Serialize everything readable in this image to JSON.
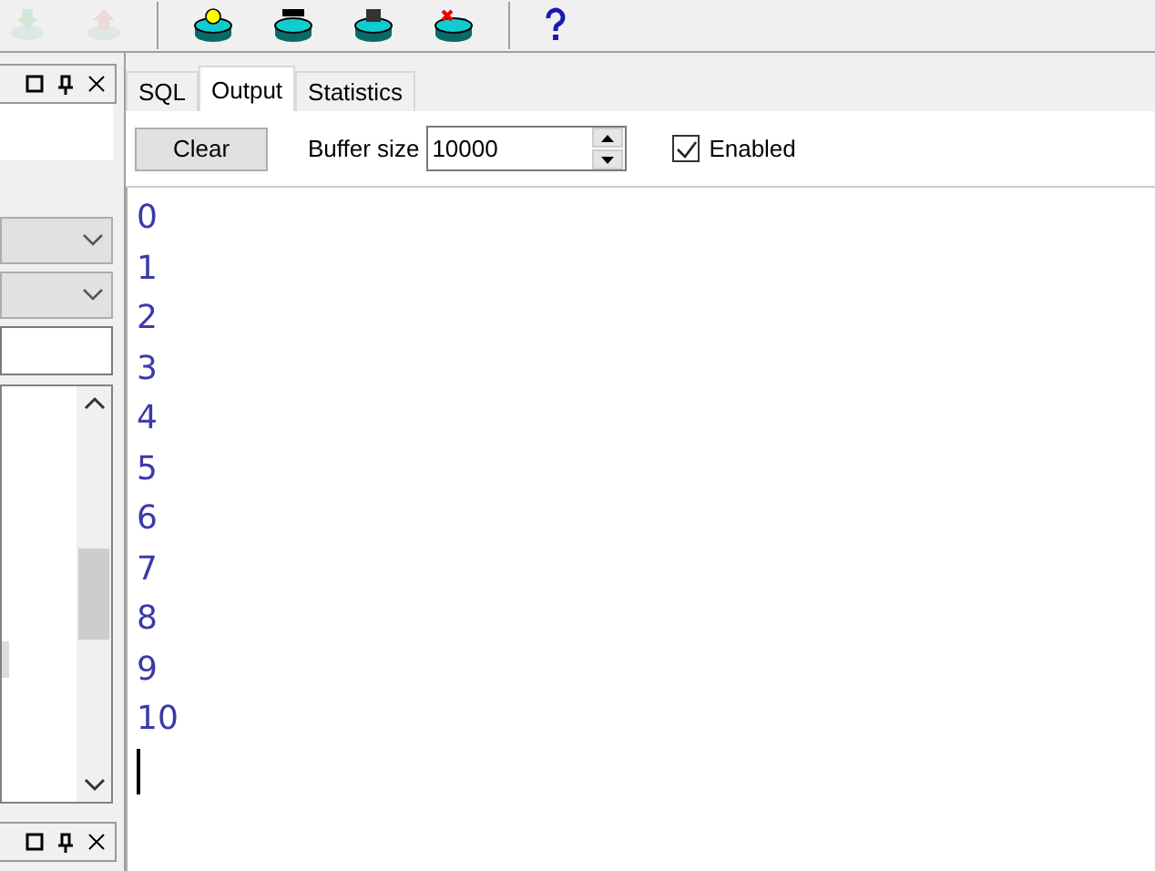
{
  "toolbar": [
    {
      "kind": "import",
      "disabled": true
    },
    {
      "kind": "export",
      "disabled": true
    },
    {
      "kind": "db-bulb",
      "disabled": false
    },
    {
      "kind": "db-label",
      "disabled": false
    },
    {
      "kind": "db-grid",
      "disabled": false
    },
    {
      "kind": "db-delete",
      "disabled": false
    },
    {
      "kind": "help",
      "disabled": false
    }
  ],
  "left_panel": {
    "dropdowns": [
      {
        "disabled": true
      },
      {
        "disabled": true
      }
    ]
  },
  "tabs": [
    {
      "label": "SQL",
      "selected": false
    },
    {
      "label": "Output",
      "selected": true
    },
    {
      "label": "Statistics",
      "selected": false
    }
  ],
  "output_toolbar": {
    "clear_button": "Clear",
    "buffer_label": "Buffer size",
    "buffer_value": "10000",
    "enabled_label": "Enabled",
    "enabled_checked": true
  },
  "output_lines": [
    "0",
    "1",
    "2",
    "3",
    "4",
    "5",
    "6",
    "7",
    "8",
    "9",
    "10"
  ]
}
